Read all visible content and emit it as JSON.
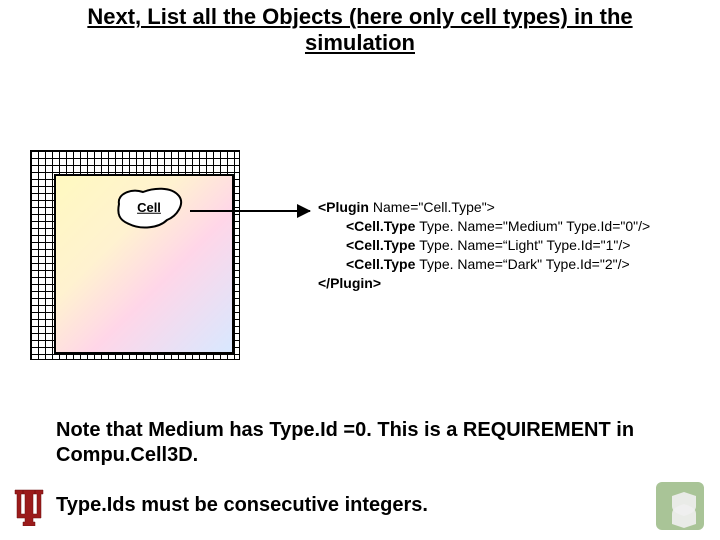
{
  "title": "Next, List all the Objects (here only cell types) in the simulation",
  "diagram": {
    "cell_label": "Cell"
  },
  "code": {
    "l1a": "<Plugin ",
    "l1b": "Name=\"Cell.Type\">",
    "l2a": "<Cell.Type ",
    "l2b": "Type. Name=\"Medium\" Type.Id=\"0\"/>",
    "l3a": "<Cell.Type ",
    "l3b": "Type. Name=“Light\" Type.Id=\"1\"/>",
    "l4a": "<Cell.Type ",
    "l4b": "Type. Name=“Dark\" Type.Id=\"2\"/>",
    "l5": "</Plugin>"
  },
  "notes": {
    "line1": "Note that Medium has Type.Id =0. This is a REQUIREMENT in Compu.Cell3D.",
    "line2": "Type.Ids must be consecutive integers."
  },
  "icons": {
    "iu": "iu-logo",
    "cc3d": "cc3d-logo"
  }
}
